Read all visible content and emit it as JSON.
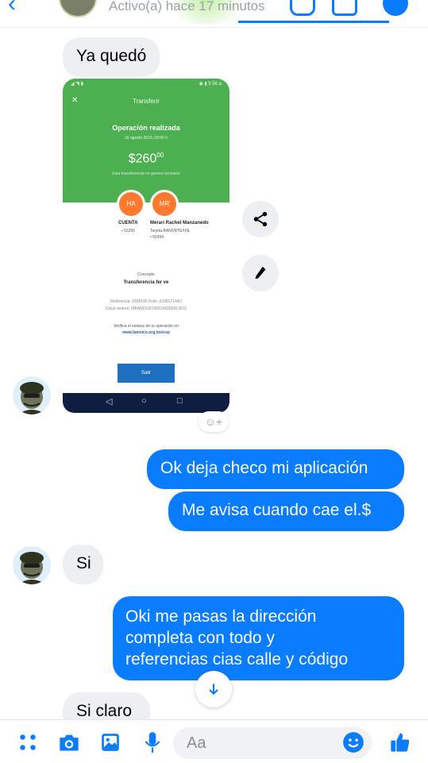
{
  "header": {
    "status": "Activo(a) hace 17 minutos"
  },
  "colors": {
    "accent": "#0a7cff",
    "incoming": "#eeeff2",
    "transfer_green": "#4caf50"
  },
  "messages": [
    {
      "side": "in",
      "text": "Ya quedó"
    },
    {
      "side": "out",
      "text": "Ok deja checo mi aplicación"
    },
    {
      "side": "out",
      "text": "Me avisa cuando cae el.$"
    },
    {
      "side": "in",
      "text": "Si"
    },
    {
      "side": "out",
      "lines": [
        "Oki me pasas la dirección",
        "completa con todo y",
        "referencias cias calle y código"
      ]
    },
    {
      "side": "in",
      "text": "Si claro"
    }
  ],
  "transfer_image": {
    "status_left": "◢ ◥ ▮",
    "status_right": "◉ ▮ 9:56 a",
    "close": "✕",
    "title": "Transferir",
    "headline": "Operación realizada",
    "date": "16 agosto 2019, 09:56 h",
    "amount_main": "$260",
    "amount_cents": "00",
    "note": "Esta transferencia no genera comisión",
    "from_initials": "HA",
    "to_initials": "MR",
    "from_label": "CUENTA",
    "from_account": "• 53255",
    "to_name": "Merari Rachel Manzanedo",
    "to_bank": "Tarjeta BANORTE/IXE",
    "to_account": "• 60394",
    "concepto_label": "Concepto",
    "concepto_value": "Transferencia fer ve",
    "reference": "Referencia: 1608190   Folio: #3381714A7",
    "tracking_key": "Clave rastreo: MBAN01001908160003413631",
    "verify_text": "Verifica el estatus de tu operación en",
    "verify_url": "www.banxico.org.mx/cep",
    "exit_button": "Salir",
    "nav": [
      "◁",
      "○",
      "□"
    ]
  },
  "actions": {
    "share_icon": "share-icon",
    "edit_icon": "pencil-icon"
  },
  "composer": {
    "placeholder": "Aa"
  },
  "icons": [
    "menu-icon",
    "camera-icon",
    "gallery-icon",
    "microphone-icon",
    "emoji-icon",
    "like-icon"
  ]
}
